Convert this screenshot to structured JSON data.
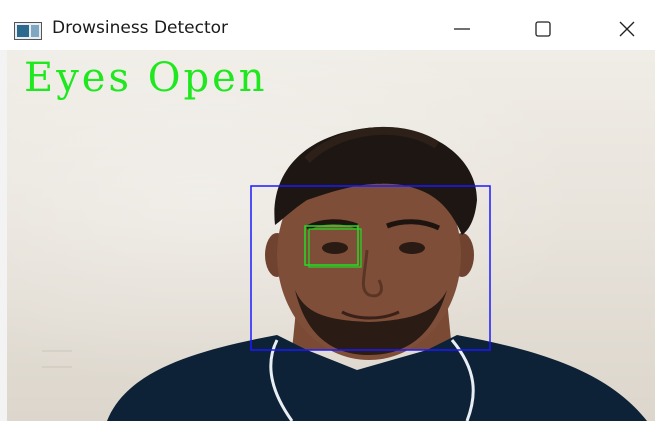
{
  "window": {
    "title": "Drowsiness Detector",
    "controls": {
      "minimize_icon": "minimize-icon",
      "maximize_icon": "maximize-icon",
      "close_icon": "close-icon"
    }
  },
  "video": {
    "status_text": "Eyes Open",
    "status_color": "#1fe81f",
    "face_box_color": "#1a1aff",
    "eye_box_color": "#22dd22"
  }
}
